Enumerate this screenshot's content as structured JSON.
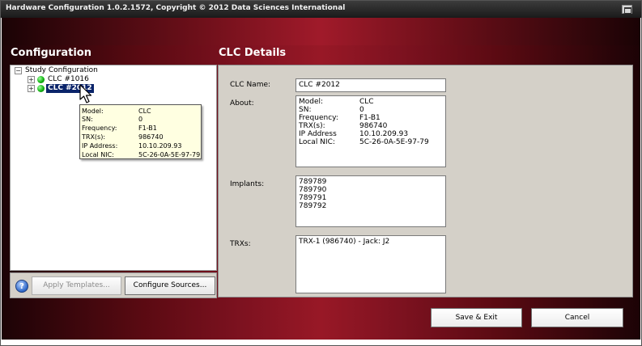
{
  "window": {
    "title": "Hardware Configuration 1.0.2.1572, Copyright © 2012 Data Sciences International"
  },
  "configuration": {
    "heading": "Configuration",
    "tree": {
      "root_label": "Study Configuration",
      "root_expander": "−",
      "nodes": [
        {
          "label": "CLC #1016",
          "expander": "+",
          "status": "online",
          "selected": false
        },
        {
          "label": "CLC #2012",
          "expander": "+",
          "status": "online",
          "selected": true
        }
      ]
    },
    "tooltip": {
      "rows": [
        {
          "key": "Model:",
          "value": "CLC"
        },
        {
          "key": "SN:",
          "value": "0"
        },
        {
          "key": "Frequency:",
          "value": "F1-B1"
        },
        {
          "key": "TRX(s):",
          "value": "986740"
        },
        {
          "key": "IP Address:",
          "value": "10.10.209.93"
        },
        {
          "key": "Local NIC:",
          "value": "5C-26-0A-5E-97-79"
        }
      ]
    },
    "buttons": {
      "help_glyph": "?",
      "apply_templates": "Apply Templates...",
      "configure_sources": "Configure Sources..."
    }
  },
  "details": {
    "heading": "CLC Details",
    "clc_name_label": "CLC Name:",
    "clc_name_value": "CLC #2012",
    "about_label": "About:",
    "about": [
      {
        "key": "Model:",
        "value": "CLC"
      },
      {
        "key": "SN:",
        "value": "0"
      },
      {
        "key": "Frequency:",
        "value": "F1-B1"
      },
      {
        "key": "TRX(s):",
        "value": "986740"
      },
      {
        "key": "IP Address",
        "value": "10.10.209.93"
      },
      {
        "key": "Local NIC:",
        "value": "5C-26-0A-5E-97-79"
      }
    ],
    "implants_label": "Implants:",
    "implants": [
      "789789",
      "789790",
      "789791",
      "789792"
    ],
    "trxs_label": "TRXs:",
    "trxs": [
      "TRX-1 (986740) - Jack: J2"
    ]
  },
  "footer": {
    "save_exit": "Save & Exit",
    "cancel": "Cancel"
  },
  "colors": {
    "frame_dark": "#1c0306",
    "frame_accent": "#a01a2a",
    "panel_bg": "#d4d0c8",
    "selection": "#0a246a",
    "tooltip_bg": "#ffffe1"
  }
}
